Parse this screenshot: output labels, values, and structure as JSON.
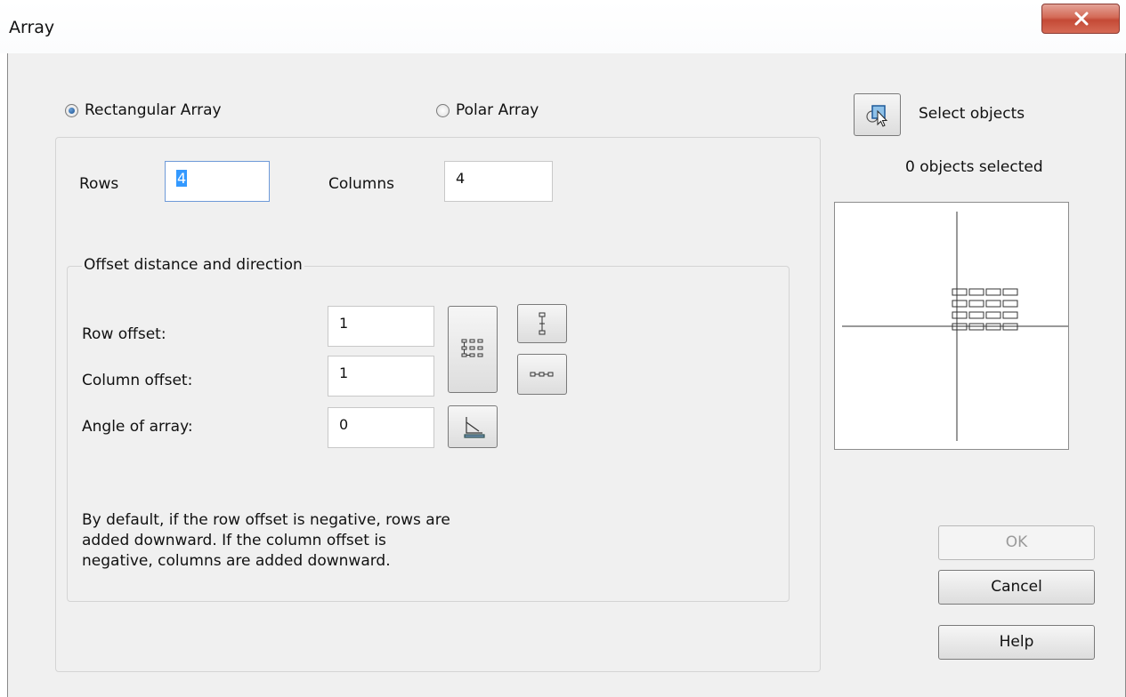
{
  "window": {
    "title": "Array"
  },
  "mode": {
    "rectangular_label": "Rectangular Array",
    "polar_label": "Polar Array",
    "selected": "rectangular"
  },
  "grid": {
    "rows_label": "Rows",
    "rows_value": "4",
    "columns_label": "Columns",
    "columns_value": "4"
  },
  "offset": {
    "group_label": "Offset distance and direction",
    "row_offset_label": "Row offset:",
    "row_offset_value": "1",
    "column_offset_label": "Column offset:",
    "column_offset_value": "1",
    "angle_label": "Angle of array:",
    "angle_value": "0"
  },
  "note": "By default, if the row offset is negative, rows are added downward. If the column offset is negative, columns are added downward.",
  "selection": {
    "button_label": "Select objects",
    "status": "0 objects selected"
  },
  "preview": {
    "rows": 4,
    "columns": 4
  },
  "buttons": {
    "ok": "OK",
    "cancel": "Cancel",
    "help": "Help"
  },
  "icons": {
    "close": "close-x-icon",
    "select": "select-objects-icon",
    "pick_both": "pick-both-offsets-icon",
    "pick_row": "pick-row-offset-icon",
    "pick_column": "pick-column-offset-icon",
    "pick_angle": "pick-angle-icon"
  },
  "colors": {
    "accent": "#3399ff",
    "close_button": "#c44a36"
  }
}
